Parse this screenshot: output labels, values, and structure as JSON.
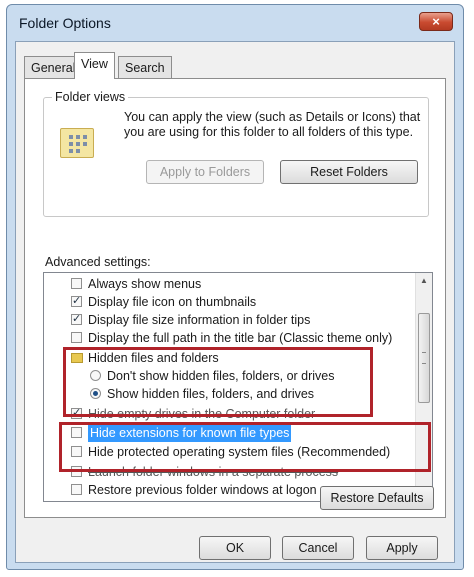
{
  "window": {
    "title": "Folder Options",
    "close_glyph": "×"
  },
  "tabs": [
    {
      "label": "General",
      "active": false
    },
    {
      "label": "View",
      "active": true
    },
    {
      "label": "Search",
      "active": false
    }
  ],
  "folder_views": {
    "label": "Folder views",
    "description": "You can apply the view (such as Details or Icons) that you are using for this folder to all folders of this type.",
    "apply_button": "Apply to Folders",
    "reset_button": "Reset Folders"
  },
  "advanced": {
    "label": "Advanced settings:",
    "items": [
      {
        "kind": "checkbox",
        "label": "Always show menus",
        "checked": false
      },
      {
        "kind": "checkbox",
        "label": "Display file icon on thumbnails",
        "checked": true
      },
      {
        "kind": "checkbox",
        "label": "Display file size information in folder tips",
        "checked": true
      },
      {
        "kind": "checkbox",
        "label": "Display the full path in the title bar (Classic theme only)",
        "checked": false
      },
      {
        "kind": "folder",
        "label": "Hidden files and folders"
      },
      {
        "kind": "radio",
        "label": "Don't show hidden files, folders, or drives",
        "selected": false
      },
      {
        "kind": "radio",
        "label": "Show hidden files, folders, and drives",
        "selected": true
      },
      {
        "kind": "checkbox",
        "label": "Hide empty drives in the Computer folder",
        "checked": true
      },
      {
        "kind": "checkbox",
        "label": "Hide extensions for known file types",
        "checked": false,
        "highlighted": true
      },
      {
        "kind": "checkbox",
        "label": "Hide protected operating system files (Recommended)",
        "checked": false
      },
      {
        "kind": "checkbox",
        "label": "Launch folder windows in a separate process",
        "checked": false
      },
      {
        "kind": "checkbox",
        "label": "Restore previous folder windows at logon",
        "checked": false
      }
    ],
    "restore_button": "Restore Defaults"
  },
  "footer": {
    "ok": "OK",
    "cancel": "Cancel",
    "apply": "Apply"
  },
  "colors": {
    "highlight_box": "#b0232a",
    "selection": "#3399ff",
    "titlebar": "#c9dcef"
  },
  "icons": {
    "check": "✓",
    "scroll_up": "▲",
    "scroll_down": "▼"
  }
}
